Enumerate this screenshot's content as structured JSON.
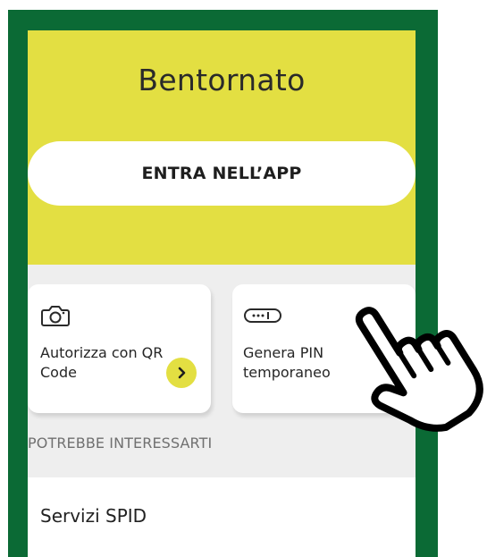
{
  "header": {
    "welcome_text": "Bentornato"
  },
  "primary_action": {
    "label": "ENTRA NELL’APP"
  },
  "quick_actions": [
    {
      "label": "Autorizza con QR Code",
      "icon": "camera-icon",
      "has_arrow": true
    },
    {
      "label": "Genera PIN temporaneo",
      "icon": "pin-field-icon",
      "has_arrow": false
    }
  ],
  "section": {
    "title": "POTREBBE INTERESSARTI"
  },
  "services": [
    {
      "label": "Servizi SPID"
    }
  ],
  "colors": {
    "frame_green": "#0b6a35",
    "accent_yellow": "#e3df42",
    "background": "#eeeeee"
  },
  "overlay": {
    "icon": "pointing-hand-cursor-icon"
  }
}
